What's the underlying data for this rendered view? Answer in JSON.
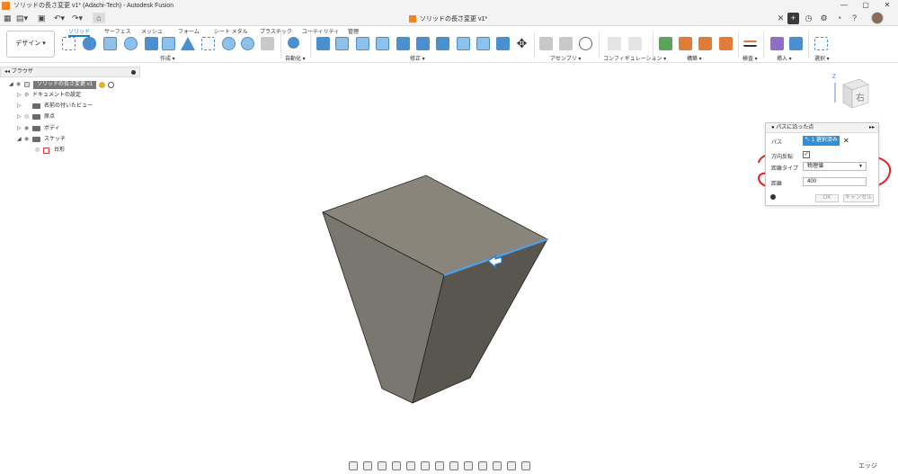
{
  "window": {
    "title": "ソリッドの長さ変更 v1* (Adachi-Tech) - Autodesk Fusion",
    "controls": [
      "—",
      "▢",
      "✕"
    ]
  },
  "tabbar": {
    "document_tab": "ソリッドの長さ変更 v1*",
    "close": "✕",
    "plus": "+",
    "icons": [
      "clock-icon",
      "gear-icon",
      "bell-icon",
      "help-icon"
    ]
  },
  "ribbon": {
    "workspace": "デザイン ▾",
    "tabs": [
      "ソリッド",
      "サーフェス",
      "メッシュ",
      "フォーム",
      "シート メタル",
      "プラスチック",
      "ユーティリティ",
      "管理"
    ],
    "groups": [
      "作成 ▾",
      "自動化 ▾",
      "修正 ▾",
      "アセンブリ ▾",
      "コンフィギュレーション ▾",
      "構築 ▾",
      "検査 ▾",
      "挿入 ▾",
      "選択 ▾"
    ]
  },
  "browser": {
    "header": "ブラウザ",
    "root": "ソリッドの長さ変更 v1",
    "items": [
      {
        "label": "ドキュメントの設定"
      },
      {
        "label": "名前の付いたビュー"
      },
      {
        "label": "原点"
      },
      {
        "label": "ボディ"
      },
      {
        "label": "スケッチ"
      },
      {
        "label": "台形"
      }
    ]
  },
  "viewcube": {
    "face_label": "右",
    "axis_label": "Z"
  },
  "dialog": {
    "title": "パスに沿った点",
    "path_label": "パス",
    "selection_button": "1 選択済み",
    "clear": "✕",
    "flip_label": "方向反転",
    "distance_type_label": "距離タイプ",
    "distance_type_value": "物理値",
    "distance_label": "距離",
    "distance_value": "400",
    "ok": "OK",
    "cancel": "キャンセル"
  },
  "status": {
    "selection_filter": "エッジ"
  },
  "colors": {
    "accent": "#2f8fd8",
    "annotation": "#e02020",
    "solid_top": "#8a857a",
    "solid_left": "#7a7770",
    "solid_right": "#595650"
  }
}
